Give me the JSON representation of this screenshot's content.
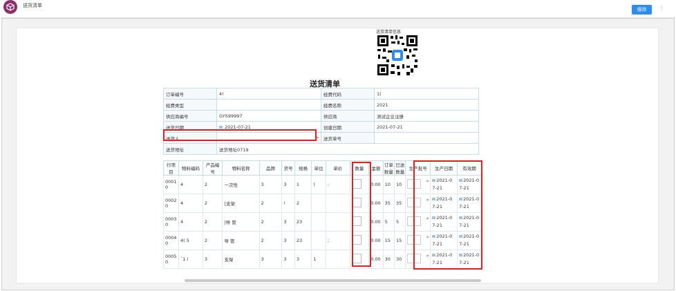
{
  "app": {
    "title": "送货清单"
  },
  "toolbar": {
    "save_label": "保存",
    "more": "⋮"
  },
  "qr": {
    "label": "送货清单信息"
  },
  "document": {
    "title": "送货清单",
    "info_rows": [
      {
        "l1": "订单编号",
        "v1": "4!",
        "l2": "经费代码",
        "v2": "1("
      },
      {
        "l1": "经费类型",
        "v1": "",
        "l2": "经费名称",
        "v2": "2021"
      },
      {
        "l1": "供应商编号",
        "v1": "GYS99997",
        "l2": "供应商",
        "v2": "测试企业注册"
      },
      {
        "l1": "送货日期",
        "v1": "2021-07-21",
        "l2": "创建日期",
        "v2": "2021-07-21"
      },
      {
        "l1": "送货人",
        "v1": "",
        "l2": "送货单号",
        "v2": ""
      },
      {
        "l1": "送货地址",
        "v1": "送货地址0719",
        "l2": "",
        "v2": ""
      }
    ],
    "required_mark": "*"
  },
  "items": {
    "headers": [
      "行项目",
      "物料编码",
      "产品编号",
      "物料名称",
      "品牌",
      "货号",
      "规格",
      "单位",
      "单价",
      "数量",
      "金额",
      "订单数量",
      "已送数量",
      "生产批号",
      "生产日期",
      "有效期"
    ],
    "rows": [
      {
        "line": "0001 0",
        "mat": "4",
        "prod": "2",
        "name": "一次性",
        "brand": "3",
        "art": "3",
        "spec": "1",
        "unit": "l",
        "price": ":",
        "amount": "0.00",
        "order_qty": "10",
        "sent_qty": "10",
        "prod_date": "2021-0 7-21",
        "expiry": "2021-0 7-21"
      },
      {
        "line": "0002 0",
        "mat": "4",
        "prod": "2",
        "name": "[支架",
        "brand": "2",
        "art": "!",
        "spec": "2",
        "unit": "",
        "price": "",
        "amount": "0.00",
        "order_qty": "35",
        "sent_qty": "35",
        "prod_date": "2021-0 7-21",
        "expiry": "2021-0 7-21"
      },
      {
        "line": "0003 0",
        "mat": "4",
        "prod": "2",
        "name": "|导 管",
        "brand": "2",
        "art": "3",
        "spec": "23",
        "unit": "",
        "price": "",
        "amount": "0.00",
        "order_qty": "5",
        "sent_qty": "5",
        "prod_date": "2021-0 7-21",
        "expiry": "2021-0 7-21"
      },
      {
        "line": "0004 0",
        "mat": "4( 5",
        "prod": "2",
        "name": "导 管",
        "brand": "2",
        "art": "3",
        "spec": "23",
        "unit": "",
        "price": ";",
        "amount": "0.00",
        "order_qty": "15",
        "sent_qty": "15",
        "prod_date": "2021-0 7-21",
        "expiry": "2021-0 7-21"
      },
      {
        "line": "0005 0",
        "mat": "´1 i",
        "prod": "3",
        "name": "支架",
        "brand": "3",
        "art": "3",
        "spec": "3",
        "unit": "1",
        "price": "",
        "amount": "0.00",
        "order_qty": "30",
        "sent_qty": "30",
        "prod_date": "2021-0 7-21",
        "expiry": "2021-0 7-21"
      }
    ]
  }
}
